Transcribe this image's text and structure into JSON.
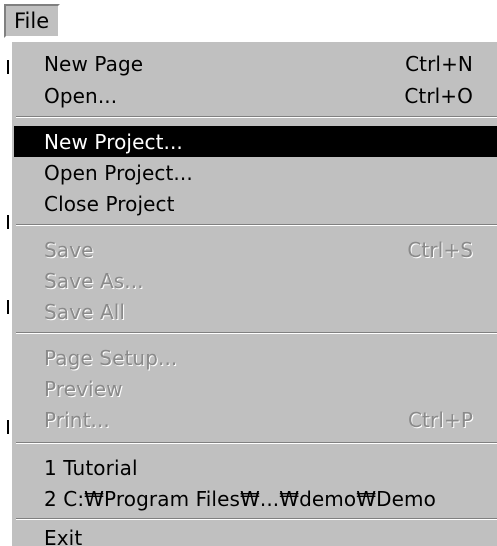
{
  "menubar": {
    "title": "File"
  },
  "menu": {
    "items": [
      {
        "label": "New Page",
        "shortcut": "Ctrl+N",
        "enabled": true,
        "highlighted": false
      },
      {
        "label": "Open...",
        "shortcut": "Ctrl+O",
        "enabled": true,
        "highlighted": false
      },
      {
        "label": "New Project...",
        "shortcut": "",
        "enabled": true,
        "highlighted": true
      },
      {
        "label": "Open Project...",
        "shortcut": "",
        "enabled": true,
        "highlighted": false
      },
      {
        "label": "Close Project",
        "shortcut": "",
        "enabled": true,
        "highlighted": false
      },
      {
        "label": "Save",
        "shortcut": "Ctrl+S",
        "enabled": false,
        "highlighted": false
      },
      {
        "label": "Save As...",
        "shortcut": "",
        "enabled": false,
        "highlighted": false
      },
      {
        "label": "Save All",
        "shortcut": "",
        "enabled": false,
        "highlighted": false
      },
      {
        "label": "Page Setup...",
        "shortcut": "",
        "enabled": false,
        "highlighted": false
      },
      {
        "label": "Preview",
        "shortcut": "",
        "enabled": false,
        "highlighted": false
      },
      {
        "label": "Print...",
        "shortcut": "Ctrl+P",
        "enabled": false,
        "highlighted": false
      },
      {
        "label": "1 Tutorial",
        "shortcut": "",
        "enabled": true,
        "highlighted": false
      },
      {
        "label": "2 C:₩Program Files₩...₩demo₩Demo",
        "shortcut": "",
        "enabled": true,
        "highlighted": false
      },
      {
        "label": "Exit",
        "shortcut": "",
        "enabled": true,
        "highlighted": false
      }
    ]
  },
  "colors": {
    "menu_background": "#c0c0c0",
    "highlight_background": "#000000",
    "highlight_text": "#ffffff",
    "disabled_text": "#8a8a8a"
  }
}
